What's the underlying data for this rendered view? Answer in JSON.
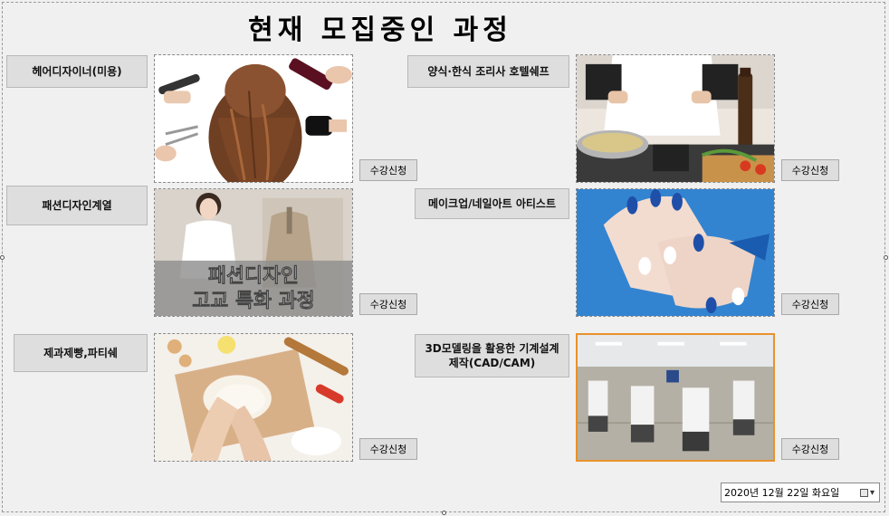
{
  "title": "현재 모집중인 과정",
  "courses": [
    {
      "label": "헤어디자이너(미용)",
      "button": "수강신청",
      "image": "hair-photo"
    },
    {
      "label": "양식·한식 조리사 호텔쉐프",
      "button": "수강신청",
      "image": "chef-photo"
    },
    {
      "label": "패션디자인계열",
      "button": "수강신청",
      "image": "fashion-photo",
      "overlay_line1": "패션디자인",
      "overlay_line2": "고교 특화 과정"
    },
    {
      "label": "메이크업/네일아트 아티스트",
      "button": "수강신청",
      "image": "nail-photo"
    },
    {
      "label": "제과제빵,파티쉐",
      "button": "수강신청",
      "image": "baking-photo"
    },
    {
      "label": "3D모델링을 활용한 기계설계 제작(CAD/CAM)",
      "button": "수강신청",
      "image": "cad-lab-photo"
    }
  ],
  "date_picker": {
    "value": "2020년 12월 22일 화요일",
    "icon": "calendar-dropdown-icon"
  },
  "colors": {
    "background": "#f0f0f0",
    "label_bg": "#dedede",
    "button_bg": "#dedede",
    "nail_blue": "#2a7ac8"
  }
}
